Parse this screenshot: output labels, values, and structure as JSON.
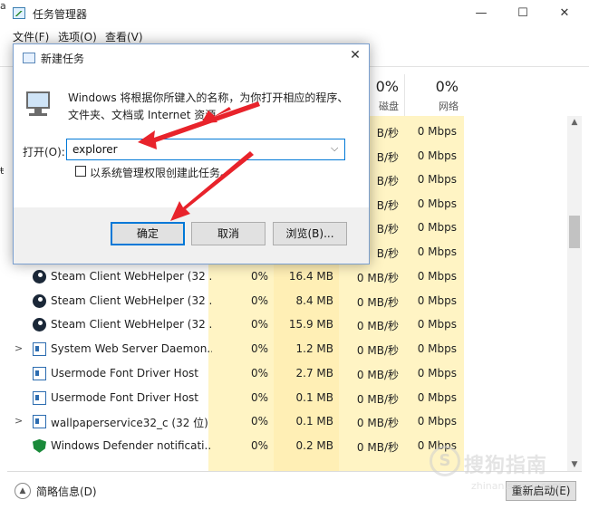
{
  "task_manager": {
    "title": "任务管理器",
    "menu": [
      "文件(F)",
      "选项(O)",
      "查看(V)"
    ],
    "columns": {
      "disk": {
        "percent": "0%",
        "label": "磁盘"
      },
      "network": {
        "percent": "0%",
        "label": "网络"
      }
    },
    "partial_rows": [
      {
        "disk": "B/秒",
        "net": "0 Mbps"
      },
      {
        "disk": "B/秒",
        "net": "0 Mbps"
      },
      {
        "disk": "B/秒",
        "net": "0 Mbps"
      },
      {
        "disk": "B/秒",
        "net": "0 Mbps"
      },
      {
        "disk": "B/秒",
        "net": "0 Mbps"
      },
      {
        "disk": "B/秒",
        "net": "0 Mbps"
      }
    ],
    "rows": [
      {
        "name": "Steam Client WebHelper (32 ...",
        "cpu": "0%",
        "mem": "16.4 MB",
        "disk": "0 MB/秒",
        "net": "0 Mbps",
        "icon": "steam-icon",
        "expand": ""
      },
      {
        "name": "Steam Client WebHelper (32 ...",
        "cpu": "0%",
        "mem": "8.4 MB",
        "disk": "0 MB/秒",
        "net": "0 Mbps",
        "icon": "steam-icon",
        "expand": ""
      },
      {
        "name": "Steam Client WebHelper (32 ...",
        "cpu": "0%",
        "mem": "15.9 MB",
        "disk": "0 MB/秒",
        "net": "0 Mbps",
        "icon": "steam-icon",
        "expand": ""
      },
      {
        "name": "System Web Server Daemon...",
        "cpu": "0%",
        "mem": "1.2 MB",
        "disk": "0 MB/秒",
        "net": "0 Mbps",
        "icon": "app-icon",
        "expand": ">"
      },
      {
        "name": "Usermode Font Driver Host",
        "cpu": "0%",
        "mem": "2.7 MB",
        "disk": "0 MB/秒",
        "net": "0 Mbps",
        "icon": "app-icon",
        "expand": ""
      },
      {
        "name": "Usermode Font Driver Host",
        "cpu": "0%",
        "mem": "0.1 MB",
        "disk": "0 MB/秒",
        "net": "0 Mbps",
        "icon": "app-icon",
        "expand": ""
      },
      {
        "name": "wallpaperservice32_c (32 位)",
        "cpu": "0%",
        "mem": "0.1 MB",
        "disk": "0 MB/秒",
        "net": "0 Mbps",
        "icon": "app-icon",
        "expand": ">"
      },
      {
        "name": "Windows Defender notificati...",
        "cpu": "0%",
        "mem": "0.2 MB",
        "disk": "0 MB/秒",
        "net": "0 Mbps",
        "icon": "shield-icon",
        "expand": ""
      }
    ],
    "footer": {
      "fewer_details": "简略信息(D)",
      "restart": "重新启动(E)"
    },
    "watermark": {
      "cn": "搜狗指南",
      "en": "zhinan.sogou.com"
    }
  },
  "run_dialog": {
    "title": "新建任务",
    "description": "Windows 将根据你所键入的名称，为你打开相应的程序、文件夹、文档或 Internet 资源。",
    "open_label": "打开(O):",
    "open_value": "explorer",
    "admin_label": "以系统管理权限创建此任务。",
    "buttons": {
      "ok": "确定",
      "cancel": "取消",
      "browse": "浏览(B)..."
    }
  },
  "clipped_left": [
    "a",
    "ŧ"
  ],
  "annotation_color": "#e8232b"
}
